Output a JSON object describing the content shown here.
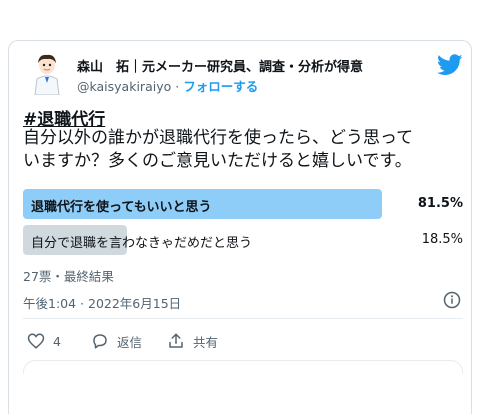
{
  "author": {
    "display_name": "森山　拓｜元メーカー研究員、調査・分析が得意",
    "handle": "@kaisyakiraiyo",
    "separator": "·",
    "follow_label": "フォローする"
  },
  "tweet": {
    "hashtag": "#退職代行",
    "text_line1": "自分以外の誰かが退職代行を使ったら、どう思って",
    "text_line2": "いますか？多くのご意見いただけると嬉しいです。"
  },
  "poll": {
    "options": [
      {
        "label": "退職代行を使ってもいいと思う",
        "percent_text": "81.5%",
        "percent": 81.5,
        "winner": true
      },
      {
        "label": "自分で退職を言わなきゃだめだと思う",
        "percent_text": "18.5%",
        "percent": 18.5,
        "winner": false
      }
    ],
    "meta": "27票・最終結果"
  },
  "timestamp": "午後1:04 · 2022年6月15日",
  "actions": {
    "like_count": "4",
    "reply_label": "返信",
    "share_label": "共有"
  },
  "colors": {
    "accent": "#1d9bf0",
    "winner_bar": "#8ecdf8",
    "other_bar": "#cfd9de",
    "like_red": "#f91880"
  },
  "icons": [
    "avatar",
    "twitter-bird-icon",
    "info-icon",
    "heart-icon",
    "reply-icon",
    "share-icon"
  ]
}
